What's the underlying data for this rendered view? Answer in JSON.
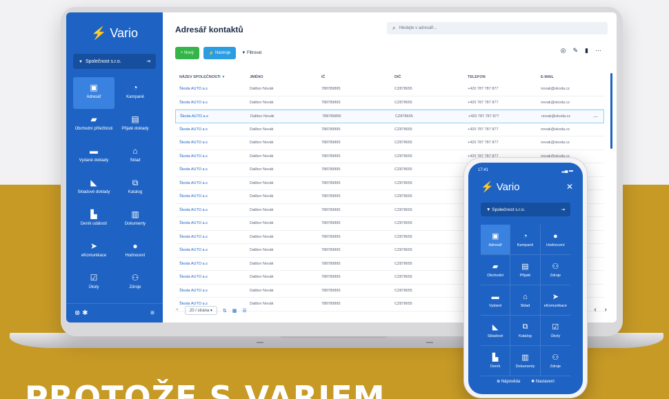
{
  "headline": "PROTOŽE S VARIEM",
  "app": {
    "logo": "Vario",
    "company": "Společnost s.r.o.",
    "sidebar": [
      {
        "label": "Adresář",
        "icon": "contact-book-icon",
        "active": true
      },
      {
        "label": "Kampaně",
        "icon": "campaign-icon",
        "active": false
      },
      {
        "label": "Obchodní příležitosti",
        "icon": "briefcase-icon",
        "active": false
      },
      {
        "label": "Přijaté doklady",
        "icon": "document-in-icon",
        "active": false
      },
      {
        "label": "Vydané doklady",
        "icon": "document-out-icon",
        "active": false
      },
      {
        "label": "Sklad",
        "icon": "warehouse-icon",
        "active": false
      },
      {
        "label": "Skladové doklady",
        "icon": "stock-doc-icon",
        "active": false
      },
      {
        "label": "Katalog",
        "icon": "catalog-icon",
        "active": false
      },
      {
        "label": "Deník událostí",
        "icon": "journal-icon",
        "active": false
      },
      {
        "label": "Dokumenty",
        "icon": "documents-icon",
        "active": false
      },
      {
        "label": "eKomunikace",
        "icon": "send-icon",
        "active": false
      },
      {
        "label": "Hodnocení",
        "icon": "rating-icon",
        "active": false
      },
      {
        "label": "Úkoly",
        "icon": "tasks-icon",
        "active": false
      },
      {
        "label": "Zdroje",
        "icon": "people-icon",
        "active": false
      }
    ],
    "page_title": "Adresář kontaktů",
    "search_placeholder": "Hledejte v adresáři...",
    "toolbar": {
      "new_label": "Nový",
      "wizard_label": "Nástroje",
      "filter_label": "Filtrovat"
    },
    "columns": [
      "NÁZEV SPOLEČNOSTI",
      "JMÉNO",
      "IČ",
      "DIČ",
      "TELEFON",
      "E-MAIL"
    ],
    "rows": [
      [
        "Škoda AUTO a.s",
        "Dalibor Novák",
        "788789895",
        "CZ878655",
        "+420 787 787 877",
        "novak@skoda.cz"
      ],
      [
        "Škoda AUTO a.s",
        "Dalibor Novák",
        "788789895",
        "CZ878655",
        "+420 787 787 877",
        "novak@skoda.cz"
      ],
      [
        "Škoda AUTO a.s",
        "Dalibor Novák",
        "788789895",
        "CZ878655",
        "+420 787 787 877",
        "novak@skoda.cz"
      ],
      [
        "Škoda AUTO a.s",
        "Dalibor Novák",
        "788789895",
        "CZ878655",
        "+420 787 787 877",
        "novak@skoda.cz"
      ],
      [
        "Škoda AUTO a.s",
        "Dalibor Novák",
        "788789895",
        "CZ878655",
        "+420 787 787 877",
        "novak@skoda.cz"
      ],
      [
        "Škoda AUTO a.s",
        "Dalibor Novák",
        "788789895",
        "CZ878655",
        "+420 787 787 877",
        "novak@skoda.cz"
      ],
      [
        "Škoda AUTO a.s",
        "Dalibor Novák",
        "788789895",
        "CZ878655",
        "",
        ""
      ],
      [
        "Škoda AUTO a.s",
        "Dalibor Novák",
        "788789895",
        "CZ878655",
        "",
        ""
      ],
      [
        "Škoda AUTO a.s",
        "Dalibor Novák",
        "788789895",
        "CZ878655",
        "",
        ""
      ],
      [
        "Škoda AUTO a.s",
        "Dalibor Novák",
        "788789895",
        "CZ878655",
        "",
        ""
      ],
      [
        "Škoda AUTO a.s",
        "Dalibor Novák",
        "788789895",
        "CZ878655",
        "",
        ""
      ],
      [
        "Škoda AUTO a.s",
        "Dalibor Novák",
        "788789895",
        "CZ878655",
        "",
        ""
      ],
      [
        "Škoda AUTO a.s",
        "Dalibor Novák",
        "788789895",
        "CZ878655",
        "",
        ""
      ],
      [
        "Škoda AUTO a.s",
        "Dalibor Novák",
        "788789895",
        "CZ878655",
        "",
        ""
      ],
      [
        "Škoda AUTO a.s",
        "Dalibor Novák",
        "788789895",
        "CZ878655",
        "",
        ""
      ],
      [
        "Škoda AUTO a.s",
        "Dalibor Novák",
        "788789895",
        "CZ878655",
        "",
        ""
      ],
      [
        "Škoda AUTO a.s",
        "Dalibor Novák",
        "788789895",
        "CZ878655",
        "",
        ""
      ]
    ],
    "selected_row": 2,
    "per_page": "20 / strana"
  },
  "phone": {
    "time": "17:41",
    "logo": "Vario",
    "company": "Společnost s.r.o.",
    "items": [
      {
        "label": "Adresář",
        "icon": "contact-book-icon",
        "active": true
      },
      {
        "label": "Kampaně",
        "icon": "campaign-icon",
        "active": false
      },
      {
        "label": "Hodnocení",
        "icon": "rating-icon",
        "active": false
      },
      {
        "label": "Obchodní",
        "icon": "briefcase-icon",
        "active": false
      },
      {
        "label": "Přijaté",
        "icon": "document-in-icon",
        "active": false
      },
      {
        "label": "Zdroje",
        "icon": "people-icon",
        "active": false
      },
      {
        "label": "Vydané",
        "icon": "document-out-icon",
        "active": false
      },
      {
        "label": "Sklad",
        "icon": "warehouse-icon",
        "active": false
      },
      {
        "label": "eKomunikace",
        "icon": "send-icon",
        "active": false
      },
      {
        "label": "Skladové",
        "icon": "stock-doc-icon",
        "active": false
      },
      {
        "label": "Katalog",
        "icon": "catalog-icon",
        "active": false
      },
      {
        "label": "Úkoly",
        "icon": "tasks-icon",
        "active": false
      },
      {
        "label": "Deník",
        "icon": "journal-icon",
        "active": false
      },
      {
        "label": "Dokumenty",
        "icon": "documents-icon",
        "active": false
      },
      {
        "label": "Zdroje",
        "icon": "people-icon",
        "active": false
      }
    ],
    "help_label": "Nápověda",
    "settings_label": "Nastavení"
  },
  "colors": {
    "brand_blue": "#1e63c4",
    "accent_gold": "#c79a26",
    "new_green": "#35b44a"
  }
}
